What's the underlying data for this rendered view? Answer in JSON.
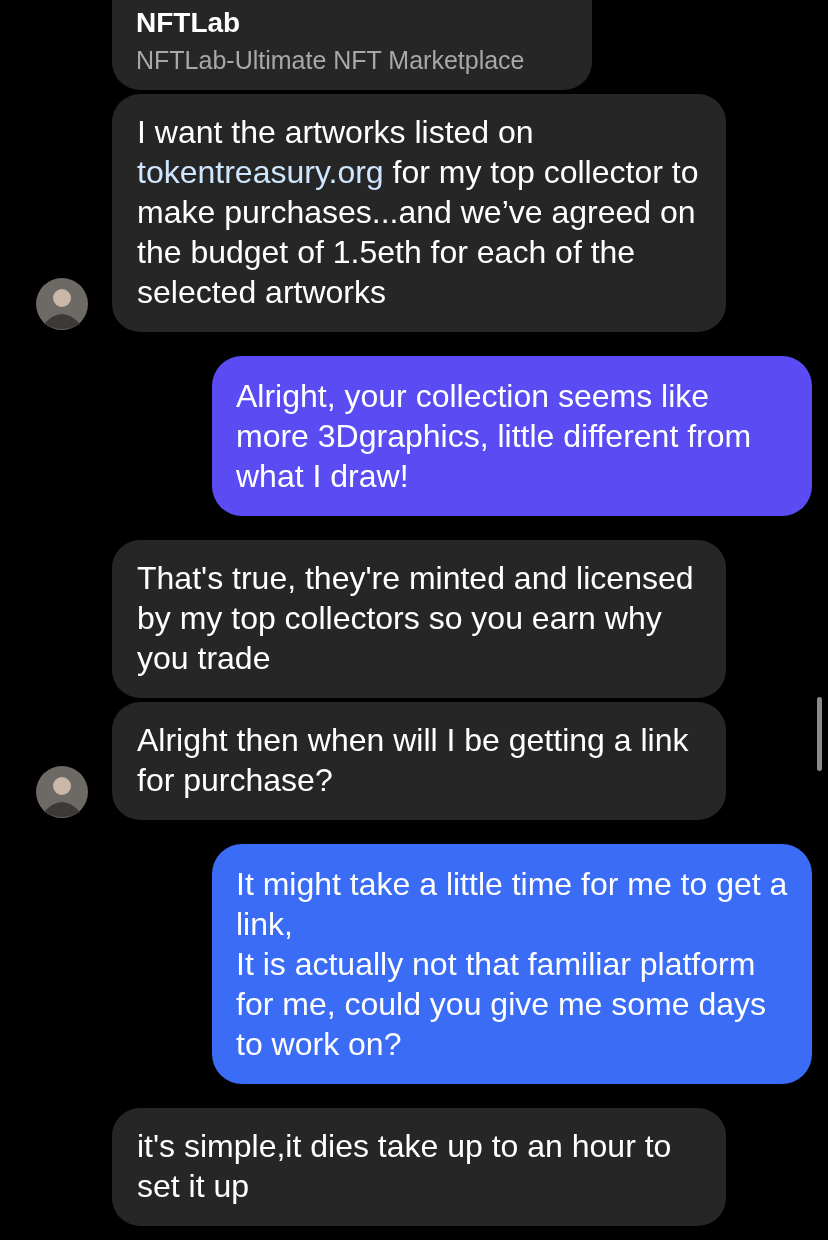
{
  "messages": [
    {
      "kind": "link_preview",
      "title": "NFTLab",
      "subtitle": "NFTLab-Ultimate NFT Marketplace"
    },
    {
      "kind": "incoming",
      "show_avatar": true,
      "segments": [
        {
          "kind": "plain",
          "text": "I want the artworks listed on "
        },
        {
          "kind": "link",
          "text": "tokentreasury.org"
        },
        {
          "kind": "plain",
          "text": " for my top collector to make purchases...and we’ve agreed on the budget of 1.5eth for each of the selected artworks"
        }
      ]
    },
    {
      "kind": "outgoing",
      "color": "#5a4cf2",
      "segments": [
        {
          "kind": "plain",
          "text": "Alright, your collection seems like more 3Dgraphics, little different from what I draw!"
        }
      ]
    },
    {
      "kind": "incoming",
      "show_avatar": false,
      "segments": [
        {
          "kind": "plain",
          "text": "That's true, they're minted and licensed by my top collectors so you earn why you trade"
        }
      ]
    },
    {
      "kind": "incoming",
      "show_avatar": true,
      "segments": [
        {
          "kind": "plain",
          "text": "Alright then when will I be getting a link for purchase?"
        }
      ]
    },
    {
      "kind": "outgoing",
      "color": "#3b6cf6",
      "segments": [
        {
          "kind": "plain",
          "text": "It might take a little time for me to get a link,\nIt is actually not that familiar platform for me, could you give me some days to work on?"
        }
      ]
    },
    {
      "kind": "incoming",
      "show_avatar": false,
      "segments": [
        {
          "kind": "plain",
          "text": "it's simple,it dies take up to an hour to set it up"
        }
      ]
    }
  ]
}
